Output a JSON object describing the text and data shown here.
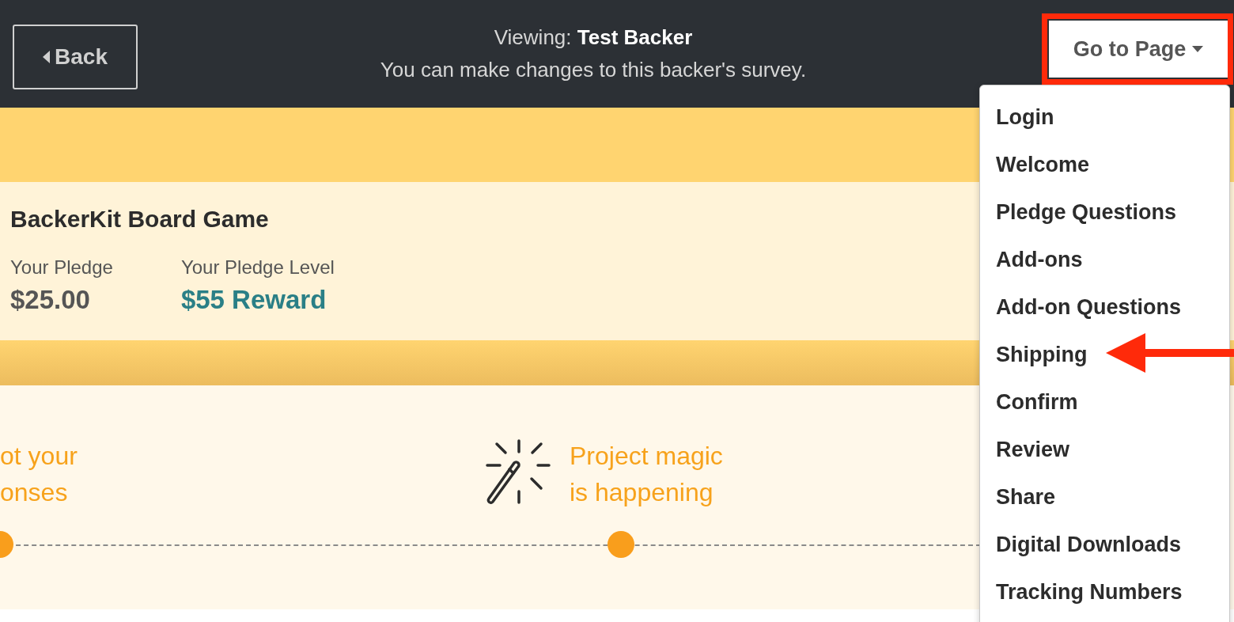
{
  "header": {
    "back_button": "Back",
    "viewing_label": "Viewing:",
    "viewing_name": "Test Backer",
    "subtitle": "You can make changes to this backer's survey.",
    "goto_button": "Go to Page"
  },
  "pledge": {
    "title": "BackerKit Board Game",
    "fields": [
      {
        "label": "Your Pledge",
        "value": "$25.00",
        "kind": "plain"
      },
      {
        "label": "Your Pledge Level",
        "value": "$55 Reward",
        "kind": "link"
      }
    ]
  },
  "steps": [
    {
      "lines": [
        "ot your",
        "onses"
      ],
      "kind": "text"
    },
    {
      "lines": [
        "Project magic",
        "is happening"
      ],
      "kind": "wand"
    }
  ],
  "menu": {
    "items": [
      "Login",
      "Welcome",
      "Pledge Questions",
      "Add-ons",
      "Add-on Questions",
      "Shipping",
      "Confirm",
      "Review",
      "Share",
      "Digital Downloads",
      "Tracking Numbers"
    ]
  },
  "annotations": {
    "highlight_box": true,
    "arrow": true
  }
}
